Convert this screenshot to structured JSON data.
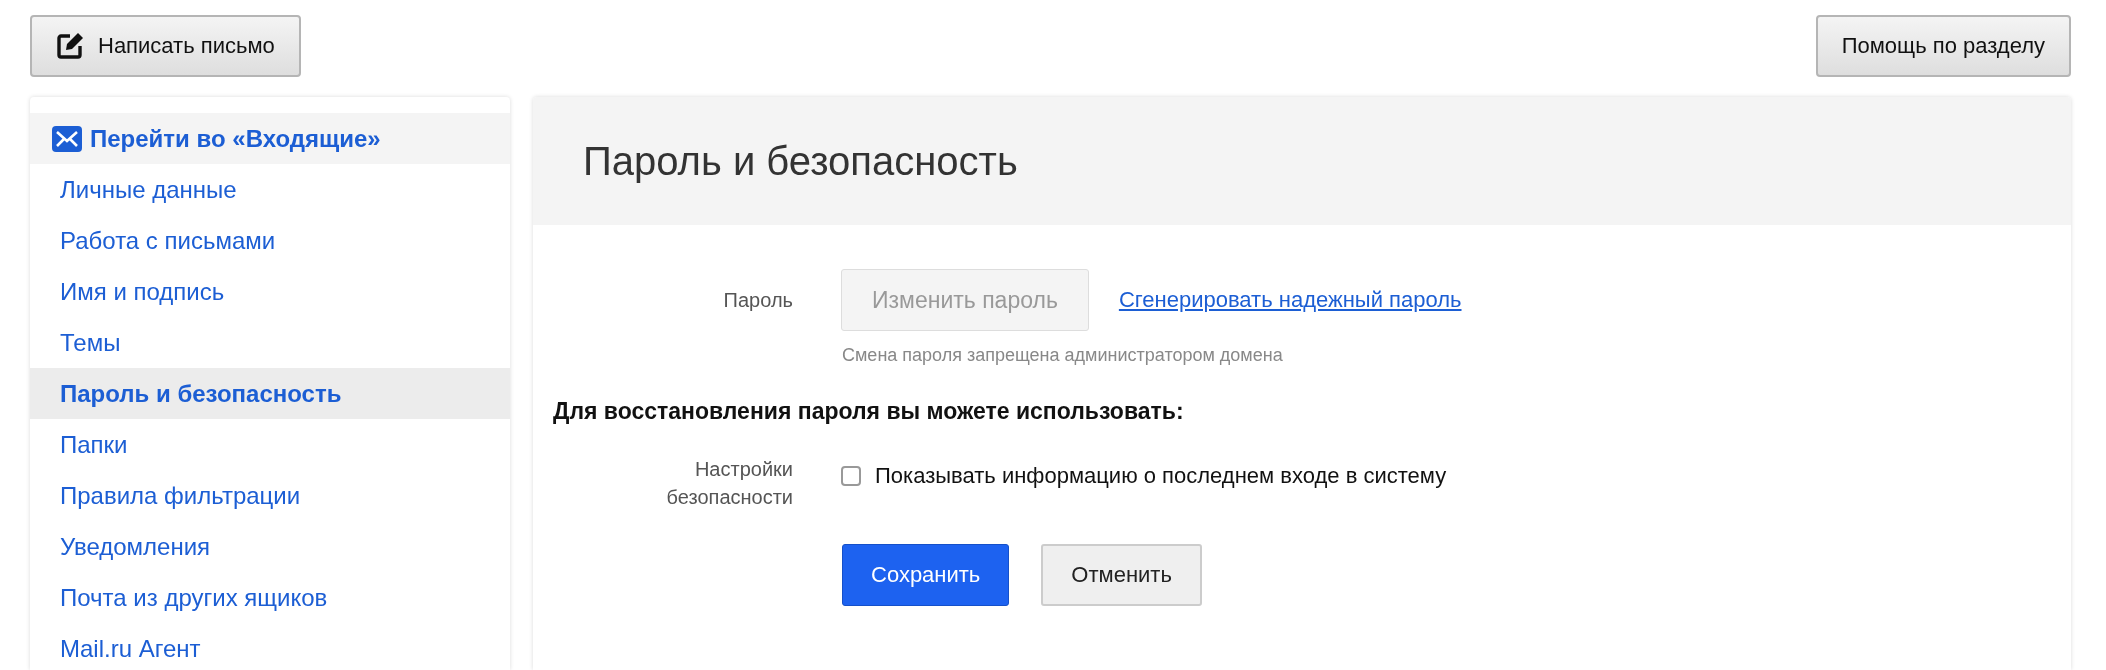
{
  "toolbar": {
    "compose_button": "Написать письмо",
    "help_button": "Помощь по разделу"
  },
  "sidebar": {
    "inbox_link": "Перейти во «Входящие»",
    "items": [
      {
        "label": "Личные данные",
        "kind": "link",
        "selected": false
      },
      {
        "label": "Работа с письмами",
        "kind": "link",
        "selected": false
      },
      {
        "label": "Имя и подпись",
        "kind": "link",
        "selected": false
      },
      {
        "label": "Темы",
        "kind": "link",
        "selected": false
      },
      {
        "label": "Пароль и безопасность",
        "kind": "link",
        "selected": true
      },
      {
        "label": "Папки",
        "kind": "link",
        "selected": false
      },
      {
        "label": "Правила фильтрации",
        "kind": "link",
        "selected": false
      },
      {
        "label": "Уведомления",
        "kind": "link",
        "selected": false
      },
      {
        "label": "Почта из других ящиков",
        "kind": "link",
        "selected": false
      },
      {
        "label": "Mail.ru Агент",
        "kind": "link",
        "selected": false
      }
    ]
  },
  "panel": {
    "title": "Пароль и безопасность",
    "password_label": "Пароль",
    "change_password_button": {
      "label": "Изменить пароль",
      "disabled": true
    },
    "generate_link": "Сгенерировать надежный пароль",
    "hint": "Смена пароля запрещена администратором домена",
    "recovery_heading": "Для восстановления пароля вы можете использовать:",
    "security_label": "Настройки безопасности",
    "last_login_checkbox": {
      "label": "Показывать информацию о последнем входе в систему",
      "checked": false
    },
    "save_button": "Сохранить",
    "cancel_button": "Отменить"
  }
}
